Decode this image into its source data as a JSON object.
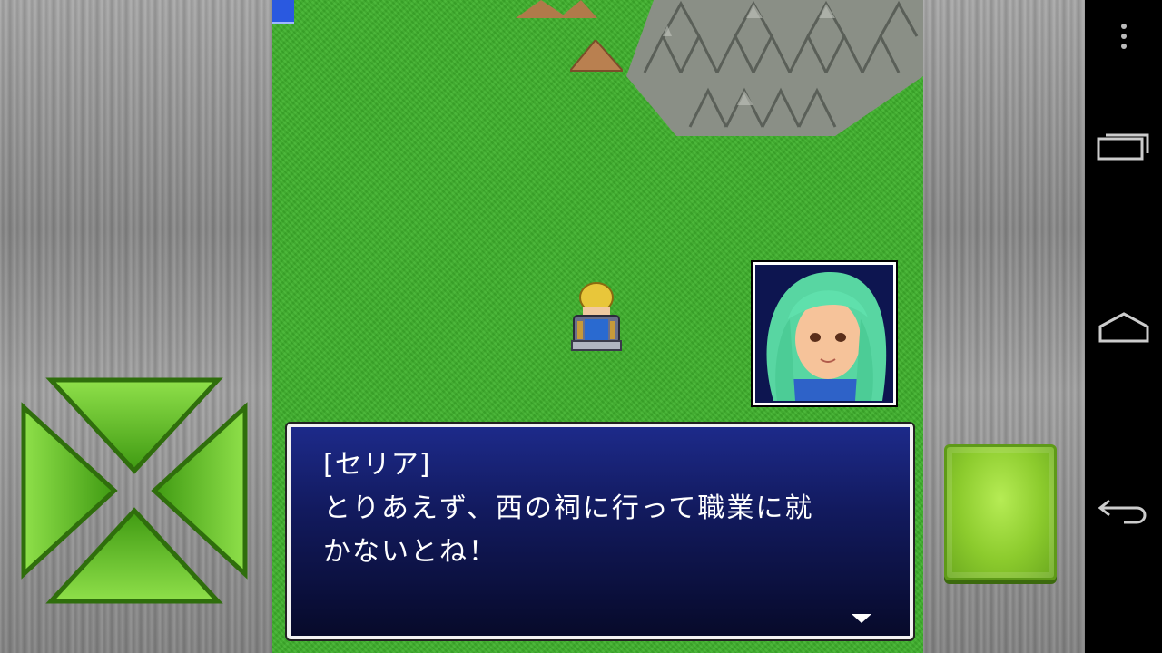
{
  "dialog": {
    "speaker": "[セリア]",
    "lines": [
      "とりあえず、西の祠に行って職業に就",
      "かないとね！"
    ]
  },
  "controls": {
    "dpad_icon": "dpad-icon",
    "action_button_icon": "action-button"
  },
  "navbar": {
    "icons": [
      "overflow-menu-icon",
      "recent-apps-icon",
      "home-icon",
      "back-icon"
    ]
  },
  "colors": {
    "grass": "#3fb22c",
    "dialog_top": "#1d2a8a",
    "dialog_bottom": "#070a2a",
    "button_green": "#8ccb2d"
  }
}
